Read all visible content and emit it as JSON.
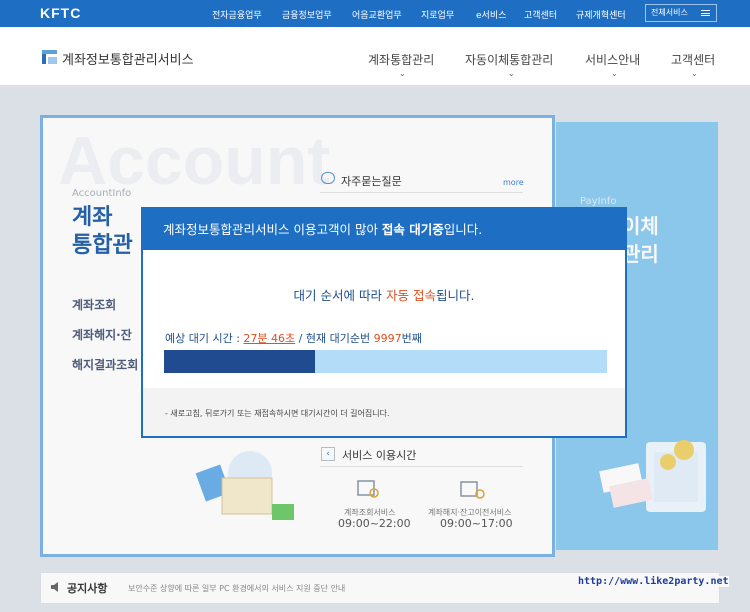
{
  "topbar": {
    "logo": "KFTC",
    "links": [
      "전자금융업무",
      "금융정보업무",
      "어음교환업무",
      "지로업무",
      "e서비스",
      "고객센터",
      "규제개혁센터"
    ],
    "all_services": "전체서비스"
  },
  "header": {
    "site_title": "계좌정보통합관리서비스",
    "menu": [
      "계좌통합관리",
      "자동이체통합관리",
      "서비스안내",
      "고객센터"
    ]
  },
  "main": {
    "bg_word": "Account",
    "sub_label": "AccountInfo",
    "title_line1": "계좌",
    "title_line2": "통합관",
    "links": [
      "계좌조회",
      "계좌해지·잔",
      "해지결과조회"
    ],
    "faq_title": "자주묻는질문",
    "faq_more": "more",
    "service_title": "서비스 이용시간",
    "services": [
      {
        "label": "계좌조회서비스",
        "time": "09:00~22:00"
      },
      {
        "label": "계좌해지·잔고이전서비스",
        "time": "09:00~17:00"
      }
    ]
  },
  "right": {
    "sub_label": "PayInfo",
    "title_line1": "이체",
    "title_line2": "관리"
  },
  "notice": {
    "label": "공지사항",
    "text": "보안수준 상향에 따른 일부 PC 환경에서의 서비스 지원 중단 안내"
  },
  "watermark": "http://www.like2party.net",
  "modal": {
    "title_pre": "계좌정보통합관리서비스 이용고객이 많아 ",
    "title_bold": "접속 대기중",
    "title_post": "입니다.",
    "msg_pre": "대기 순서에 따라 ",
    "msg_red": "자동 접속",
    "msg_post": "됩니다.",
    "eta_prefix": "예상 대기 시간 : ",
    "eta_time": "27분 46초",
    "eta_mid": " / 현재 대기순번 ",
    "queue_number": "9997",
    "eta_suffix": "번째",
    "progress": 0.34,
    "note": "- 새로고침, 뒤로가기 또는 재접속하시면 대기시간이 더 길어집니다."
  },
  "colors": {
    "primary": "#1e6fc3",
    "progress_fill": "#214b91",
    "progress_track": "#b3dcf9",
    "highlight": "#e05020"
  }
}
